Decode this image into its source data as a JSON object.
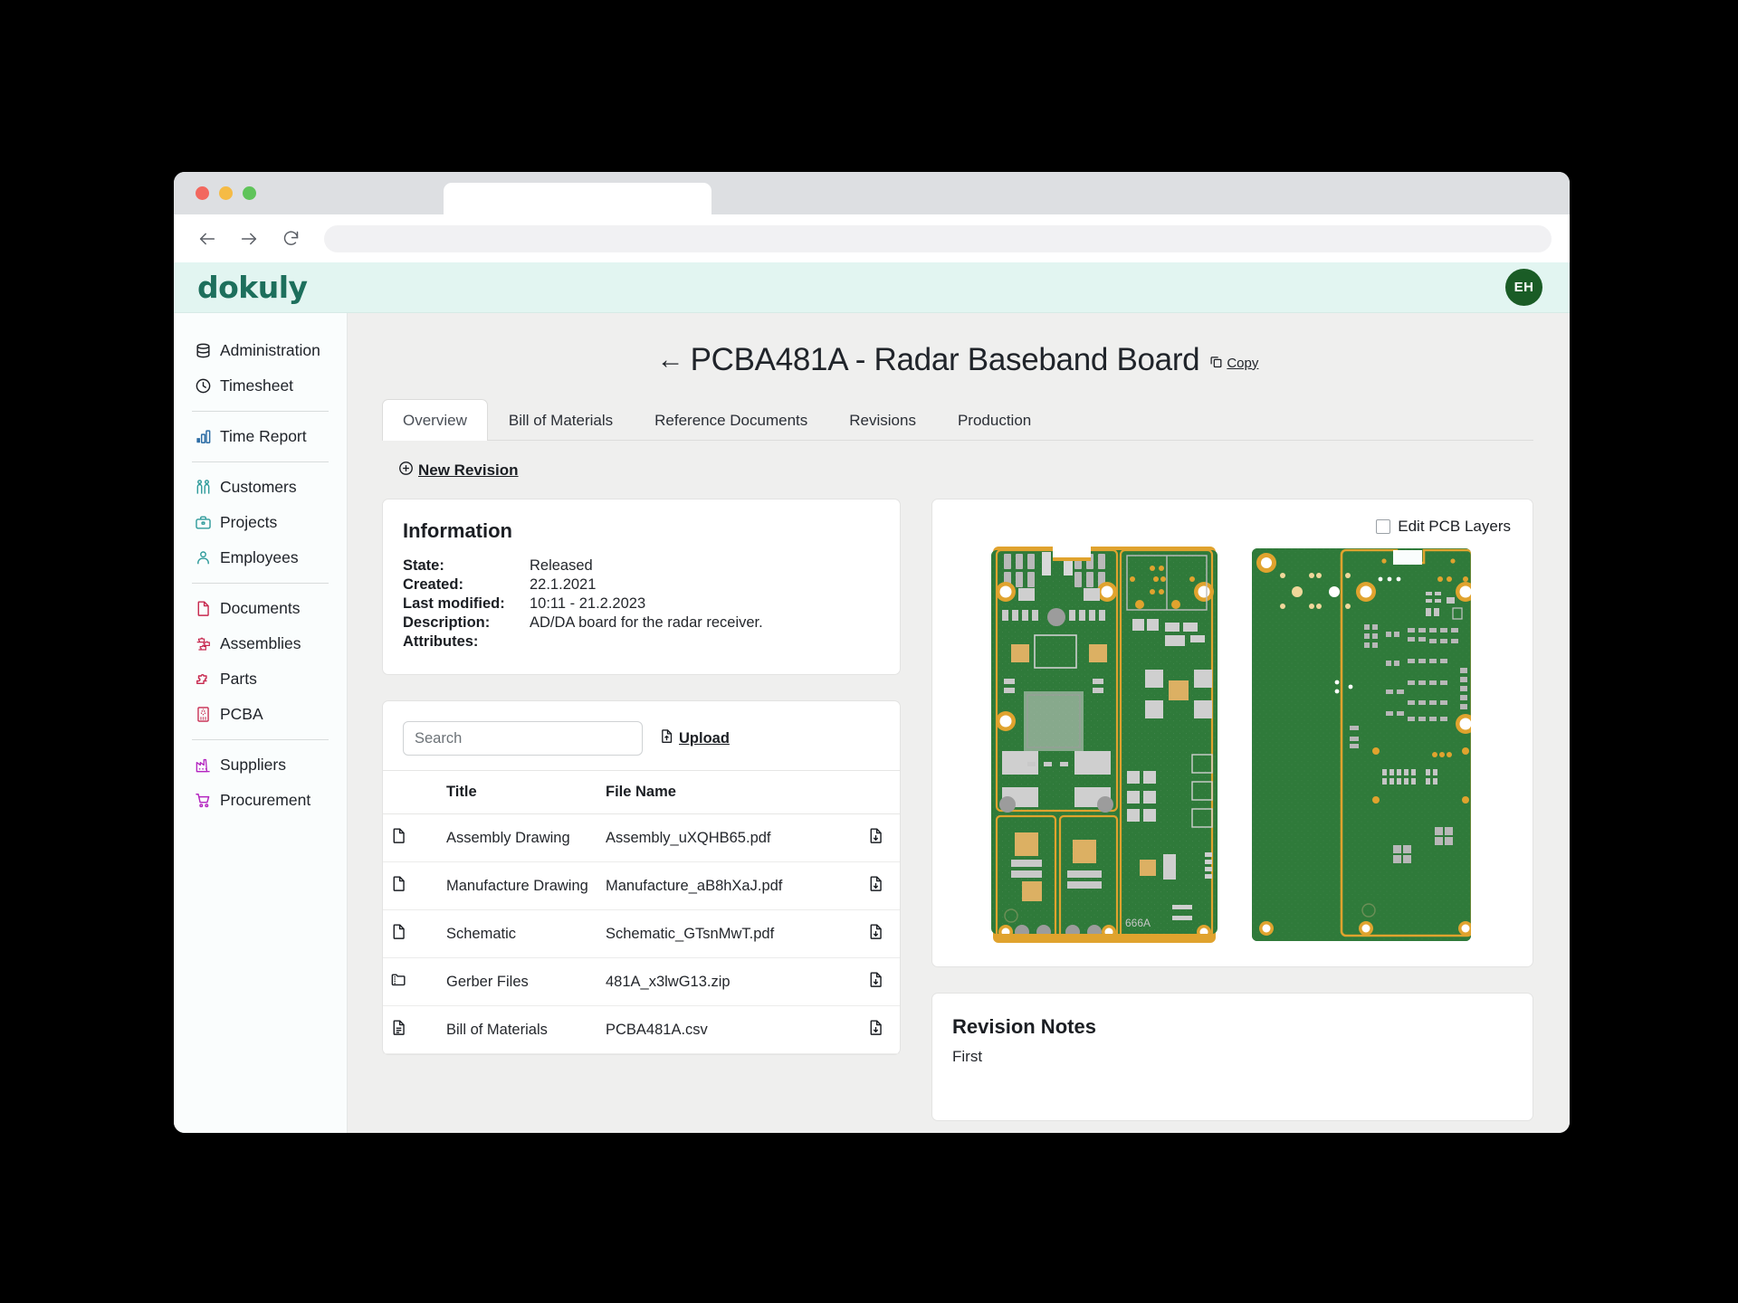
{
  "browser": {
    "back_icon": "back-arrow-icon",
    "forward_icon": "forward-arrow-icon",
    "reload_icon": "reload-icon",
    "url_value": ""
  },
  "appbar": {
    "logo_text": "dokuly",
    "avatar_initials": "EH",
    "bg_color": "#e2f5f1",
    "logo_color": "#1d6f5c",
    "avatar_color": "#1a5c26"
  },
  "sidebar": {
    "groups": [
      {
        "items": [
          {
            "label": "Administration",
            "icon": "database-icon",
            "color": "#1b1e23"
          },
          {
            "label": "Timesheet",
            "icon": "clock-icon",
            "color": "#1b1e23"
          }
        ]
      },
      {
        "items": [
          {
            "label": "Time Report",
            "icon": "bar-chart-icon",
            "color": "#2e6ea6"
          }
        ]
      },
      {
        "items": [
          {
            "label": "Customers",
            "icon": "people-icon",
            "color": "#2f9b9b"
          },
          {
            "label": "Projects",
            "icon": "briefcase-icon",
            "color": "#2f9b9b"
          },
          {
            "label": "Employees",
            "icon": "person-icon",
            "color": "#2f9b9b"
          }
        ]
      },
      {
        "items": [
          {
            "label": "Documents",
            "icon": "document-icon",
            "color": "#c7294f"
          },
          {
            "label": "Assemblies",
            "icon": "puzzle-pieces-icon",
            "color": "#c7294f"
          },
          {
            "label": "Parts",
            "icon": "puzzle-piece-icon",
            "color": "#c7294f"
          },
          {
            "label": "PCBA",
            "icon": "pcb-icon",
            "color": "#c7294f"
          }
        ]
      },
      {
        "items": [
          {
            "label": "Suppliers",
            "icon": "factory-icon",
            "color": "#b425c0"
          },
          {
            "label": "Procurement",
            "icon": "cart-icon",
            "color": "#b425c0"
          }
        ]
      }
    ]
  },
  "page": {
    "title": "PCBA481A - Radar Baseband Board",
    "back_label": "←",
    "copy_label": "Copy",
    "new_revision_label": "New Revision"
  },
  "tabs": [
    {
      "label": "Overview",
      "active": true
    },
    {
      "label": "Bill of Materials",
      "active": false
    },
    {
      "label": "Reference Documents",
      "active": false
    },
    {
      "label": "Revisions",
      "active": false
    },
    {
      "label": "Production",
      "active": false
    }
  ],
  "information": {
    "title": "Information",
    "rows": [
      {
        "key": "State:",
        "value": "Released"
      },
      {
        "key": "Created:",
        "value": "22.1.2021"
      },
      {
        "key": "Last modified:",
        "value": "10:11 - 21.2.2023"
      },
      {
        "key": "Description:",
        "value": "AD/DA board for the radar receiver."
      },
      {
        "key": "Attributes:",
        "value": ""
      }
    ]
  },
  "files": {
    "search_placeholder": "Search",
    "search_value": "",
    "upload_label": "Upload",
    "columns": [
      "",
      "Title",
      "File Name",
      ""
    ],
    "rows": [
      {
        "icon": "file-icon",
        "title": "Assembly Drawing",
        "file_name": "Assembly_uXQHB65.pdf",
        "download_icon": "download-icon"
      },
      {
        "icon": "file-icon",
        "title": "Manufacture Drawing",
        "file_name": "Manufacture_aB8hXaJ.pdf",
        "download_icon": "download-icon"
      },
      {
        "icon": "file-icon",
        "title": "Schematic",
        "file_name": "Schematic_GTsnMwT.pdf",
        "download_icon": "download-icon"
      },
      {
        "icon": "zip-folder-icon",
        "title": "Gerber Files",
        "file_name": "481A_x3lwG13.zip",
        "download_icon": "download-icon"
      },
      {
        "icon": "csv-file-icon",
        "title": "Bill of Materials",
        "file_name": "PCBA481A.csv",
        "download_icon": "download-icon"
      }
    ]
  },
  "pcb_viewer": {
    "edit_layers_label": "Edit PCB Layers",
    "edit_layers_checked": false,
    "board_silkscreen_text": "666A",
    "colors": {
      "soldermask": "#2f7a3a",
      "copper": "#e0a32e",
      "pad": "#d8d8d8",
      "silkscreen": "#d9d9d9"
    }
  },
  "revision_notes": {
    "title": "Revision Notes",
    "body": "First"
  }
}
